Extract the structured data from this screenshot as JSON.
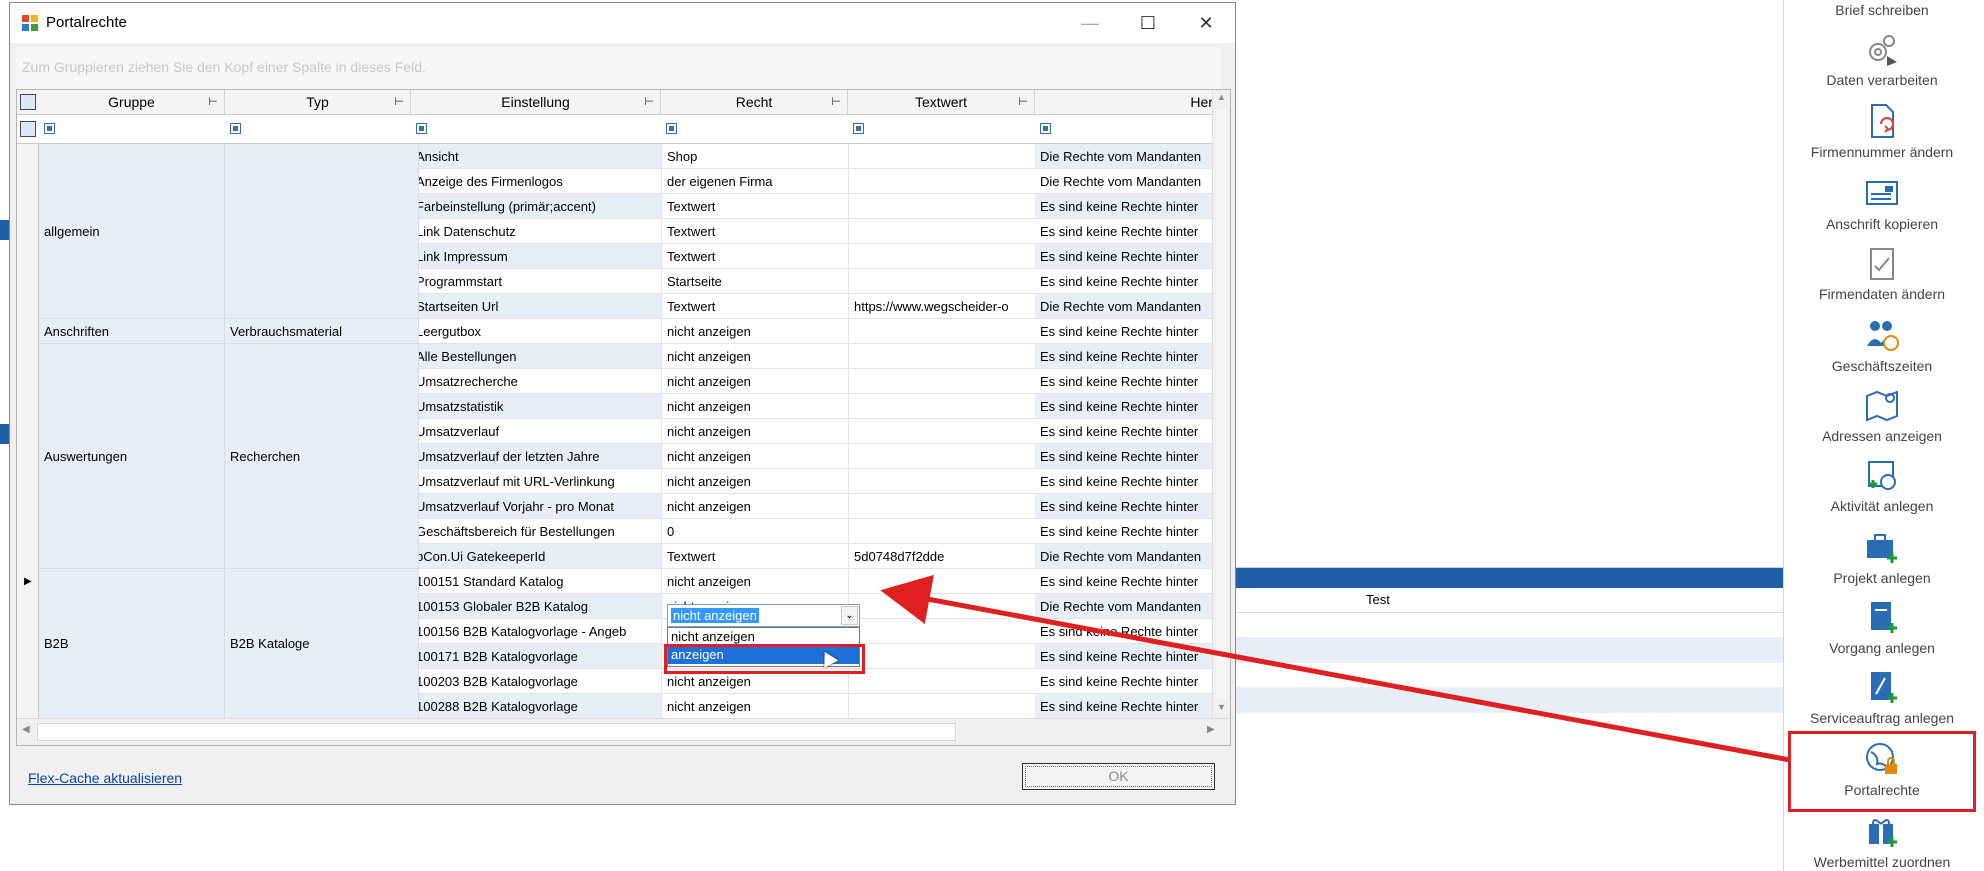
{
  "dialog": {
    "title": "Portalrechte",
    "group_hint": "Zum Gruppieren ziehen Sie den Kopf einer Spalte in dieses Feld.",
    "flex_link": "Flex-Cache aktualisieren",
    "ok_label": "OK"
  },
  "columns": [
    "Gruppe",
    "Typ",
    "Einstellung",
    "Recht",
    "Textwert",
    "Herl"
  ],
  "groups": {
    "allgemein": "allgemein",
    "anschriften": "Anschriften",
    "verbrauch": "Verbrauchsmaterial",
    "auswertungen": "Auswertungen",
    "recherchen": "Recherchen",
    "b2b": "B2B",
    "b2b_kataloge": "B2B Kataloge"
  },
  "rows": [
    {
      "einstellung": "Ansicht",
      "recht": "Shop",
      "textwert": "",
      "herl": "Die Rechte vom Mandanten"
    },
    {
      "einstellung": "Anzeige des Firmenlogos",
      "recht": "der eigenen Firma",
      "textwert": "",
      "herl": "Die Rechte vom Mandanten"
    },
    {
      "einstellung": "Farbeinstellung (primär;accent)",
      "recht": "Textwert",
      "textwert": "",
      "herl": "Es sind keine Rechte hinter"
    },
    {
      "einstellung": "Link Datenschutz",
      "recht": "Textwert",
      "textwert": "",
      "herl": "Es sind keine Rechte hinter"
    },
    {
      "einstellung": "Link Impressum",
      "recht": "Textwert",
      "textwert": "",
      "herl": "Es sind keine Rechte hinter"
    },
    {
      "einstellung": "Programmstart",
      "recht": "Startseite",
      "textwert": "",
      "herl": "Es sind keine Rechte hinter"
    },
    {
      "einstellung": "Startseiten Url",
      "recht": "Textwert",
      "textwert": "https://www.wegscheider-o",
      "herl": "Die Rechte vom Mandanten"
    },
    {
      "einstellung": "Leergutbox",
      "recht": "nicht anzeigen",
      "textwert": "",
      "herl": "Es sind keine Rechte hinter"
    },
    {
      "einstellung": "Alle Bestellungen",
      "recht": "nicht anzeigen",
      "textwert": "",
      "herl": "Es sind keine Rechte hinter"
    },
    {
      "einstellung": "Umsatzrecherche",
      "recht": "nicht anzeigen",
      "textwert": "",
      "herl": "Es sind keine Rechte hinter"
    },
    {
      "einstellung": "Umsatzstatistik",
      "recht": "nicht anzeigen",
      "textwert": "",
      "herl": "Es sind keine Rechte hinter"
    },
    {
      "einstellung": "Umsatzverlauf",
      "recht": "nicht anzeigen",
      "textwert": "",
      "herl": "Es sind keine Rechte hinter"
    },
    {
      "einstellung": "Umsatzverlauf der letzten Jahre",
      "recht": "nicht anzeigen",
      "textwert": "",
      "herl": "Es sind keine Rechte hinter"
    },
    {
      "einstellung": "Umsatzverlauf mit URL-Verlinkung",
      "recht": "nicht anzeigen",
      "textwert": "",
      "herl": "Es sind keine Rechte hinter"
    },
    {
      "einstellung": "Umsatzverlauf Vorjahr - pro Monat",
      "recht": "nicht anzeigen",
      "textwert": "",
      "herl": "Es sind keine Rechte hinter"
    },
    {
      "einstellung": "Geschäftsbereich für Bestellungen",
      "recht": "0",
      "textwert": "",
      "herl": "Es sind keine Rechte hinter"
    },
    {
      "einstellung": "pCon.Ui GatekeeperId",
      "recht": "Textwert",
      "textwert": "5d0748d7f2dde",
      "herl": "Die Rechte vom Mandanten"
    },
    {
      "einstellung": "100151 Standard Katalog",
      "recht": "nicht anzeigen",
      "textwert": "",
      "herl": "Es sind keine Rechte hinter"
    },
    {
      "einstellung": "100153 Globaler B2B Katalog",
      "recht": "nicht anzeigen",
      "textwert": "",
      "herl": "Die Rechte vom Mandanten"
    },
    {
      "einstellung": "100156 B2B Katalogvorlage - Angeb",
      "recht": "nicht anzeigen",
      "textwert": "",
      "herl": "Es sind keine Rechte hinter"
    },
    {
      "einstellung": "100171 B2B Katalogvorlage",
      "recht": "nicht anzeigen",
      "textwert": "",
      "herl": "Es sind keine Rechte hinter"
    },
    {
      "einstellung": "100203 B2B Katalogvorlage",
      "recht": "nicht anzeigen",
      "textwert": "",
      "herl": "Es sind keine Rechte hinter"
    },
    {
      "einstellung": "100288 B2B Katalogvorlage",
      "recht": "nicht anzeigen",
      "textwert": "",
      "herl": "Es sind keine Rechte hinter"
    }
  ],
  "editor": {
    "value": "nicht anzeigen",
    "options": [
      "nicht anzeigen",
      "anzeigen"
    ],
    "highlighted": "anzeigen"
  },
  "background": {
    "panel_column": "Test"
  },
  "ribbon": [
    {
      "label": "Brief schreiben",
      "icon": "letter-icon"
    },
    {
      "label": "Daten verarbeiten",
      "icon": "gears-icon"
    },
    {
      "label": "Firmennummer ändern",
      "icon": "document-refresh-icon"
    },
    {
      "label": "Anschrift kopieren",
      "icon": "address-card-icon"
    },
    {
      "label": "Firmendaten ändern",
      "icon": "clipboard-edit-icon"
    },
    {
      "label": "Geschäftszeiten",
      "icon": "people-clock-icon"
    },
    {
      "label": "Adressen anzeigen",
      "icon": "map-search-icon"
    },
    {
      "label": "Aktivität anlegen",
      "icon": "calendar-add-icon"
    },
    {
      "label": "Projekt anlegen",
      "icon": "briefcase-add-icon"
    },
    {
      "label": "Vorgang anlegen",
      "icon": "document-add-icon"
    },
    {
      "label": "Serviceauftrag anlegen",
      "icon": "service-doc-icon"
    },
    {
      "label": "Portalrechte",
      "icon": "globe-lock-icon"
    },
    {
      "label": "Werbemittel zuordnen",
      "icon": "gift-add-icon"
    }
  ],
  "colors": {
    "accent": "#1f5fa8",
    "row_alt": "#e8eef7",
    "selection": "#1e6fd6",
    "annotation": "#e02020"
  }
}
